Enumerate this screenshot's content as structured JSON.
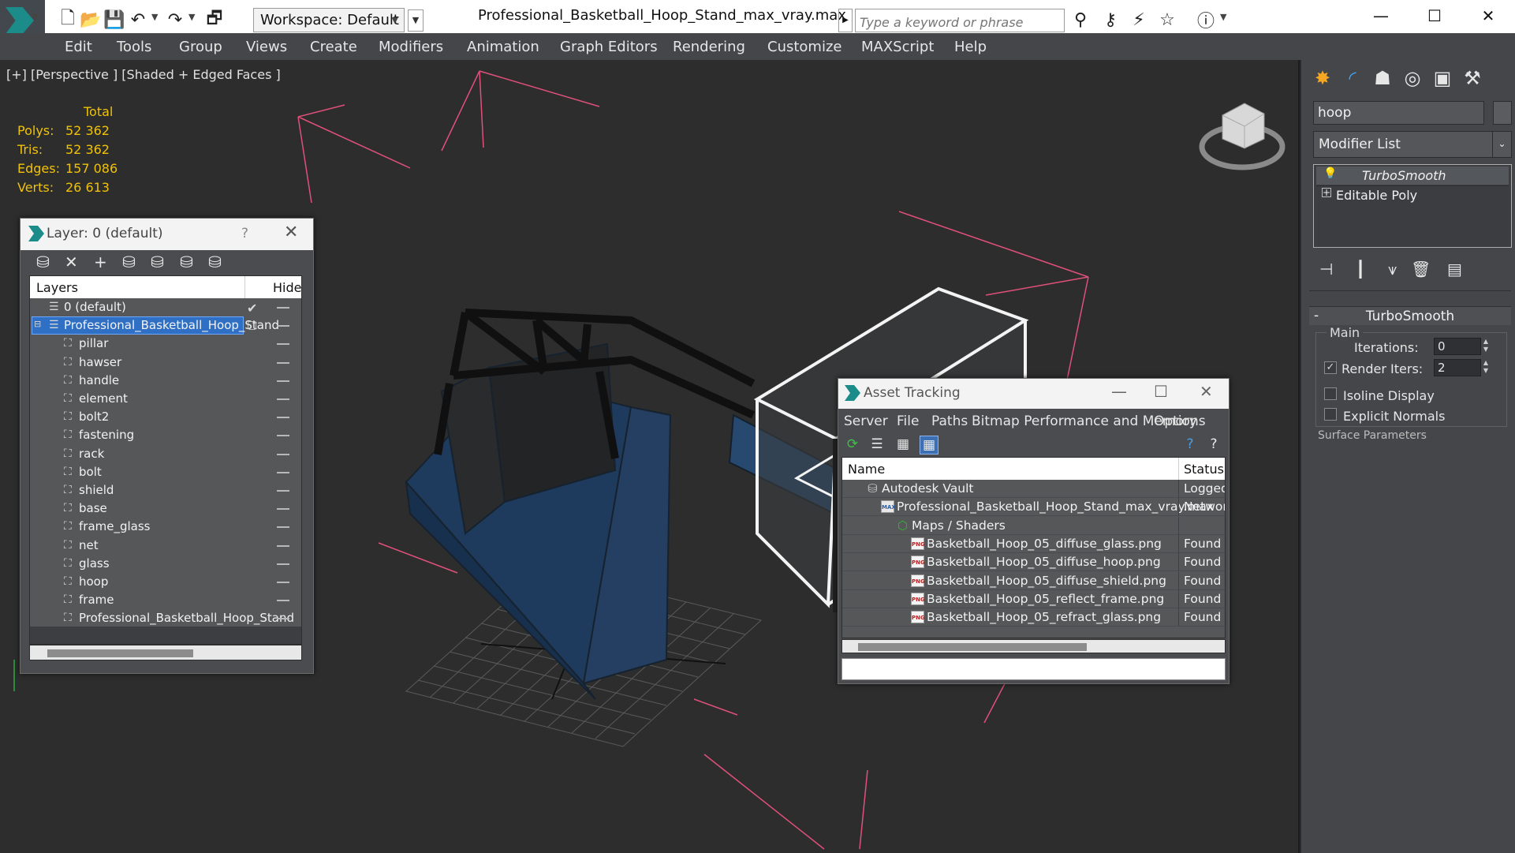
{
  "titlebar": {
    "workspace": "Workspace: Default",
    "document_title": "Professional_Basketball_Hoop_Stand_max_vray.max",
    "search_placeholder": "Type a keyword or phrase"
  },
  "menu": [
    "Edit",
    "Tools",
    "Group",
    "Views",
    "Create",
    "Modifiers",
    "Animation",
    "Graph Editors",
    "Rendering",
    "Customize",
    "MAXScript",
    "Help"
  ],
  "viewport": {
    "label": "[+] [Perspective ] [Shaded + Edged Faces ]",
    "stats": {
      "header": "Total",
      "rows": [
        {
          "label": "Polys:",
          "value": "52 362"
        },
        {
          "label": "Tris:",
          "value": "52 362"
        },
        {
          "label": "Edges:",
          "value": "157 086"
        },
        {
          "label": "Verts:",
          "value": "26 613"
        }
      ]
    }
  },
  "command_panel": {
    "object_name": "hoop",
    "modifier_list": "Modifier List",
    "stack": [
      "TurboSmooth",
      "Editable Poly"
    ],
    "rollout_title": "TurboSmooth",
    "group_main": "Main",
    "iterations_label": "Iterations:",
    "iterations_value": "0",
    "render_iters_label": "Render Iters:",
    "render_iters_value": "2",
    "isoline_label": "Isoline Display",
    "explicit_normals_label": "Explicit Normals",
    "surface_params_label": "Surface Parameters"
  },
  "layer_explorer": {
    "title": "Layer: 0 (default)",
    "help": "?",
    "col_layers": "Layers",
    "col_hide": "Hide",
    "rows": [
      {
        "name": "0 (default)",
        "indent": 1,
        "type": "layer"
      },
      {
        "name": "Professional_Basketball_Hoop_Stand",
        "indent": 1,
        "type": "layer"
      },
      {
        "name": "pillar",
        "indent": 2,
        "type": "object"
      },
      {
        "name": "hawser",
        "indent": 2,
        "type": "object"
      },
      {
        "name": "handle",
        "indent": 2,
        "type": "object"
      },
      {
        "name": "element",
        "indent": 2,
        "type": "object"
      },
      {
        "name": "bolt2",
        "indent": 2,
        "type": "object"
      },
      {
        "name": "fastening",
        "indent": 2,
        "type": "object"
      },
      {
        "name": "rack",
        "indent": 2,
        "type": "object"
      },
      {
        "name": "bolt",
        "indent": 2,
        "type": "object"
      },
      {
        "name": "shield",
        "indent": 2,
        "type": "object"
      },
      {
        "name": "base",
        "indent": 2,
        "type": "object"
      },
      {
        "name": "frame_glass",
        "indent": 2,
        "type": "object"
      },
      {
        "name": "net",
        "indent": 2,
        "type": "object"
      },
      {
        "name": "glass",
        "indent": 2,
        "type": "object"
      },
      {
        "name": "hoop",
        "indent": 2,
        "type": "object"
      },
      {
        "name": "frame",
        "indent": 2,
        "type": "object"
      },
      {
        "name": "Professional_Basketball_Hoop_Stand",
        "indent": 2,
        "type": "object"
      }
    ]
  },
  "asset_tracking": {
    "title": "Asset Tracking",
    "menu": [
      "Server",
      "File",
      "Paths",
      "Bitmap Performance and Memory",
      "Options"
    ],
    "col_name": "Name",
    "col_status": "Status",
    "rows": [
      {
        "name": "Autodesk Vault",
        "status": "Logged",
        "indent": 0,
        "icon": "vault"
      },
      {
        "name": "Professional_Basketball_Hoop_Stand_max_vray.max",
        "status": "Network",
        "indent": 1,
        "icon": "max"
      },
      {
        "name": "Maps / Shaders",
        "status": "",
        "indent": 2,
        "icon": "maps"
      },
      {
        "name": "Basketball_Hoop_05_diffuse_glass.png",
        "status": "Found",
        "indent": 3,
        "icon": "png"
      },
      {
        "name": "Basketball_Hoop_05_diffuse_hoop.png",
        "status": "Found",
        "indent": 3,
        "icon": "png"
      },
      {
        "name": "Basketball_Hoop_05_diffuse_shield.png",
        "status": "Found",
        "indent": 3,
        "icon": "png"
      },
      {
        "name": "Basketball_Hoop_05_reflect_frame.png",
        "status": "Found",
        "indent": 3,
        "icon": "png"
      },
      {
        "name": "Basketball_Hoop_05_refract_glass.png",
        "status": "Found",
        "indent": 3,
        "icon": "png"
      }
    ]
  },
  "colors": {
    "stats_yellow": "#f0c20a",
    "selection_blue": "#2f6fc4",
    "bounding_box_pink": "#e0507a",
    "brand_teal": "#1b8c8a"
  }
}
